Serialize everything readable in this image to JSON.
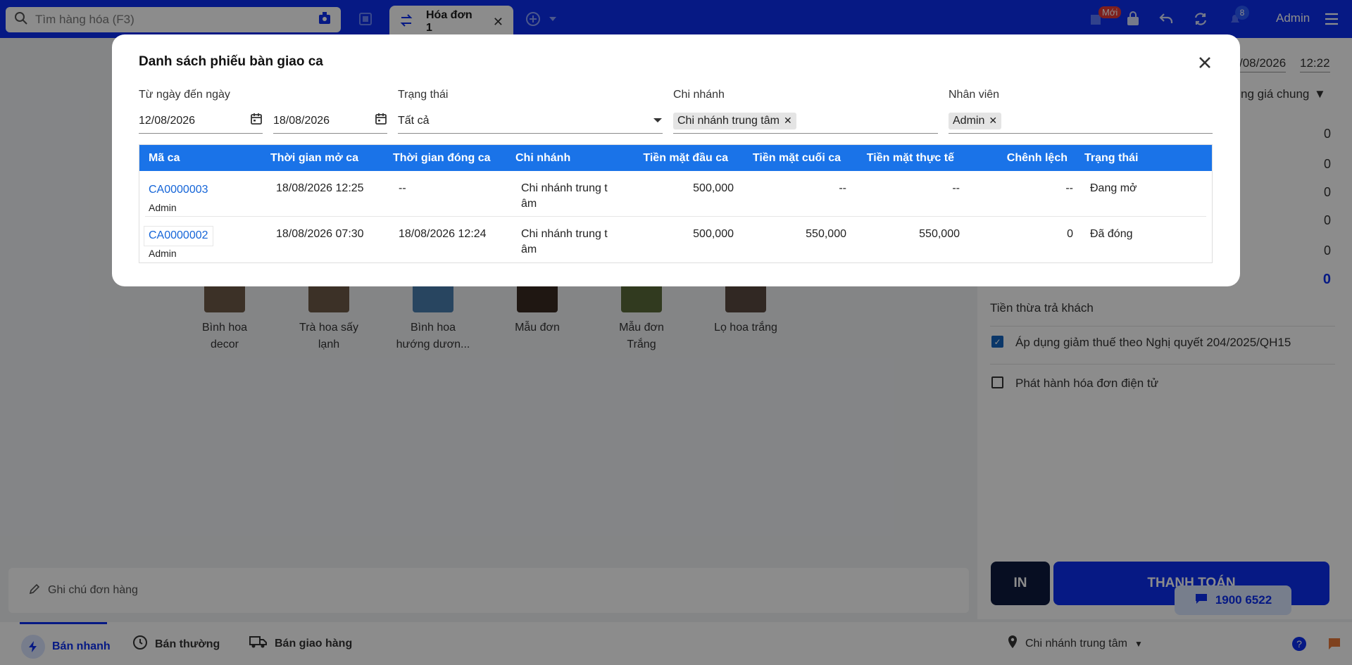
{
  "topbar": {
    "search_placeholder": "Tìm hàng hóa (F3)",
    "tab_label": "Hóa đơn 1",
    "new_badge": "Mới",
    "notification_count": "8",
    "user": "Admin"
  },
  "right_panel": {
    "date": "/08/2026",
    "time": "12:22",
    "price_list": "ng giá chung",
    "values": [
      "0",
      "0",
      "0",
      "0",
      "0",
      "0"
    ],
    "change_label": "Tiền thừa trả khách",
    "tax_checkbox_label": "Áp dụng giảm thuế theo Nghị quyết 204/2025/QH15",
    "einvoice_checkbox_label": "Phát hành hóa đơn điện tử",
    "print_button": "IN",
    "pay_button": "THANH TOÁN"
  },
  "products": [
    {
      "name_line1": "Bình hoa",
      "name_line2": "decor"
    },
    {
      "name_line1": "Trà hoa sấy",
      "name_line2": "lạnh"
    },
    {
      "name_line1": "Bình hoa",
      "name_line2": "hướng dươn..."
    },
    {
      "name_line1": "Mẫu đơn",
      "name_line2": ""
    },
    {
      "name_line1": "Mẫu đơn",
      "name_line2": "Trắng"
    },
    {
      "name_line1": "Lọ hoa trắng",
      "name_line2": ""
    }
  ],
  "order_note_placeholder": "Ghi chú đơn hàng",
  "bottombar": {
    "quick_sale": "Bán nhanh",
    "normal_sale": "Bán thường",
    "delivery_sale": "Bán giao hàng",
    "branch": "Chi nhánh trung tâm",
    "hotline": "1900 6522"
  },
  "modal": {
    "title": "Danh sách phiếu bàn giao ca",
    "filters": {
      "date_range_label": "Từ ngày đến ngày",
      "from_date": "12/08/2026",
      "to_date": "18/08/2026",
      "status_label": "Trạng thái",
      "status_value": "Tất cả",
      "branch_label": "Chi nhánh",
      "branch_chip": "Chi nhánh trung tâm",
      "staff_label": "Nhân viên",
      "staff_chip": "Admin"
    },
    "columns": [
      "Mã ca",
      "Thời gian mở ca",
      "Thời gian đóng ca",
      "Chi nhánh",
      "Tiền mặt đầu ca",
      "Tiền mặt cuối ca",
      "Tiền mặt thực tế",
      "Chênh lệch",
      "Trạng thái"
    ],
    "rows": [
      {
        "code": "CA0000003",
        "user": "Admin",
        "open_time": "18/08/2026 12:25",
        "close_time": "--",
        "branch_line1": "Chi nhánh trung t",
        "branch_line2": "âm",
        "cash_start": "500,000",
        "cash_end": "--",
        "cash_actual": "--",
        "diff": "--",
        "status": "Đang mở"
      },
      {
        "code": "CA0000002",
        "user": "Admin",
        "open_time": "18/08/2026 07:30",
        "close_time": "18/08/2026 12:24",
        "branch_line1": "Chi nhánh trung t",
        "branch_line2": "âm",
        "cash_start": "500,000",
        "cash_end": "550,000",
        "cash_actual": "550,000",
        "diff": "0",
        "status": "Đã đóng"
      }
    ]
  }
}
